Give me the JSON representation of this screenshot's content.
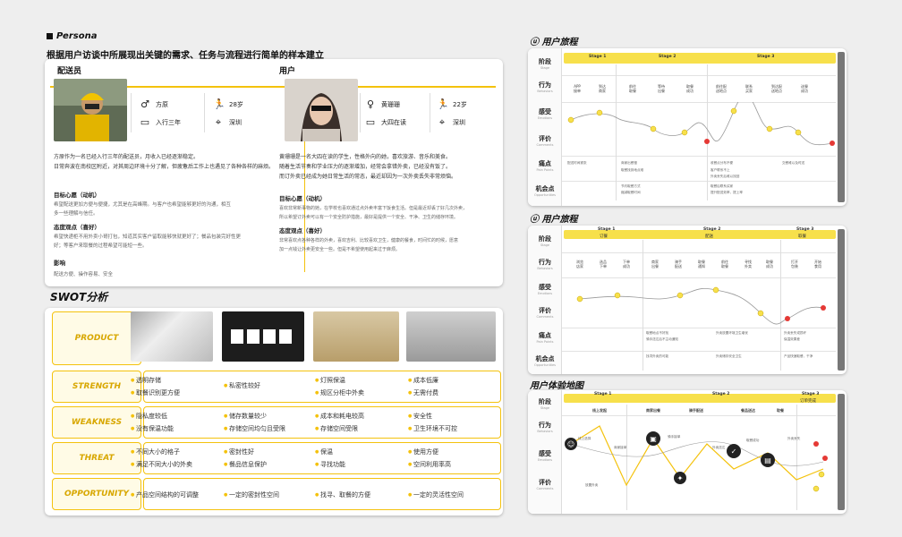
{
  "persona_header": {
    "title": "Persona",
    "subtitle": "根据用户访谈中所展现出关键的需求、任务与流程进行简单的样本建立"
  },
  "courier": {
    "title": "配送员",
    "name": "方原",
    "age": "28岁",
    "job": "入行三年",
    "city": "深圳",
    "bio": [
      "方原作为一名已经入行三年的配送员，月收入已经逐渐稳定。",
      "日常奔波在南校区附近，对其周边环境十分了解，但疲惫后工作上也遇见了各种各样的麻烦。"
    ],
    "goal_title": "目标心愿（动机）",
    "goal": [
      "希望配送更加方便与便捷，尤其是在高峰期。与客户也希望能够更好的沟通，相互",
      "多一些理解与信任。"
    ],
    "attitude_title": "态度观点（喜好）",
    "attitude": [
      "希望快递柜不用外卖小哥打包，知道其实客户留取能够快就更好了；餐品包装完好性更",
      "好；等客户来取餐的过程希望可能短一些。"
    ],
    "influence_title": "影响",
    "influence": "配送方便、操作容易、安全"
  },
  "user": {
    "title": "用户",
    "name": "黄珊珊",
    "age": "22岁",
    "job": "大四在读",
    "city": "深圳",
    "bio": [
      "黄珊珊是一名大四在读的学生，性格外向的她，喜欢旅游、音乐和美食。",
      "随着生活节奏和学业压力的逐渐增加，经常会拿错外卖，已经没有饭了。",
      "而订外卖已经成为她日常生活的常态，最近却因为一次外卖丢失非常烦恼。"
    ],
    "goal_title": "目标心愿（动机）",
    "goal": [
      "喜欢非常新事物的她，在学校也喜欢通过点外卖丰富下饭食生活。但是最近却丢了好几次外卖，",
      "所以希望订外卖可以有一个安全防护措施，最好是提供一个安全、干净、卫生的储存环境。"
    ],
    "attitude_title": "态度观点（喜好）",
    "attitude": [
      "非常喜欢点各种各样的外卖，喜欢吉利、比较喜欢卫生，健康的餐食，时间忙的时候，愿意",
      "加一点钱让外卖更安全一些。但是不希望使用起来过于麻烦。"
    ]
  },
  "swot": {
    "title": "SWOT分析",
    "rows": [
      {
        "label": "PRODUCT",
        "items": []
      },
      {
        "label": "STRENGTH",
        "items": [
          "透明存储",
          "私密性较好",
          "灯照保温",
          "成本低廉",
          "取餐识别更方便",
          "",
          "规区分柜中外卖",
          "无需付费"
        ]
      },
      {
        "label": "WEAKNESS",
        "items": [
          "隐私度较低",
          "储存数量较少",
          "成本和耗电较高",
          "安全性",
          "没有保温功能",
          "存储空间均匀且受限",
          "存储空间受限",
          "卫生环境不可控"
        ]
      },
      {
        "label": "THREAT",
        "items": [
          "不同大小的格子",
          "密封性好",
          "保温",
          "使用方便",
          "满足不同大小的外卖",
          "餐品信息保护",
          "寻找功能",
          "空间利用率高"
        ]
      },
      {
        "label": "OPPORTUNITY",
        "items": [
          "产品空间结构的可调整",
          "一定的密封性空间",
          "找寻、取餐的方便",
          "一定的灵活性空间"
        ]
      }
    ]
  },
  "journey1": {
    "title": "用户旅程",
    "rows": [
      {
        "m": "阶段",
        "s": "Stage"
      },
      {
        "m": "行为",
        "s": "Behaviors"
      },
      {
        "m": "感受",
        "s": "Emotions"
      },
      {
        "m": "评价",
        "s": "Comments"
      },
      {
        "m": "痛点",
        "s": "Pain Points"
      },
      {
        "m": "机会点",
        "s": "Opportunities"
      }
    ],
    "stages": [
      "Stage 1",
      "Stage 2",
      "Stage 3"
    ],
    "behaviors": [
      "APP\n接单",
      "到达\n商家",
      "前往\n取餐",
      "等待\n出餐",
      "取餐\n成功",
      "前往配\n送地点",
      "联系\n买家",
      "到达配\n送地点",
      "送餐\n成功"
    ],
    "pains": [
      "配送时间紧张",
      "商家出餐慢",
      "取餐找到地点难",
      "收餐点分布不便",
      "交餐难以及时送",
      "客户联系不上",
      "外卖丢失后难以找回"
    ],
    "opps": [
      "节约取餐方式",
      "缩减取餐时间",
      "取餐后联系买家",
      "提升配送效率，提上率"
    ]
  },
  "journey2": {
    "title": "用户旅程",
    "rows": [
      {
        "m": "阶段",
        "s": "Stage"
      },
      {
        "m": "行为",
        "s": "Behaviors"
      },
      {
        "m": "感受",
        "s": "Emotions"
      },
      {
        "m": "评价",
        "s": "Comments"
      },
      {
        "m": "痛点",
        "s": "Pain Points"
      },
      {
        "m": "机会点",
        "s": "Opportunities"
      }
    ],
    "stages": [
      "Stage 1",
      "Stage 2",
      "Stage 3"
    ],
    "phases": [
      "订餐",
      "配送",
      "取餐"
    ],
    "behaviors": [
      "浏览\n店家",
      "选品\n下单",
      "下单\n成功",
      "商家\n出餐",
      "骑手\n配送",
      "取餐\n通知",
      "前往\n取餐",
      "寻找\n外卖",
      "取餐\n成功",
      "打开\n包装",
      "开始\n食用"
    ],
    "pains": [
      "取餐地点不好找",
      "骑手送达后不主动通知",
      "外卖放置环境卫生堪忧",
      "外卖丢失或损坏",
      "保温效果差"
    ],
    "opps": [
      "找寻外卖的可能",
      "外卖储存安全卫生",
      "产品快速取餐，干净"
    ]
  },
  "journey3": {
    "title": "用户体验地图",
    "rows": [
      {
        "m": "阶段",
        "s": "Stage"
      },
      {
        "m": "行为",
        "s": "Behaviors"
      },
      {
        "m": "感受",
        "s": "Emotions"
      },
      {
        "m": "评价",
        "s": "Comments"
      }
    ],
    "stages": [
      "Stage 1",
      "Stage 2",
      "Stage 3"
    ],
    "phase3": "订单完成",
    "behaviors": [
      "线上发起",
      "商家出餐",
      "骑手配送",
      "餐品送达",
      "取餐"
    ],
    "notes": [
      "线上选择",
      "商家接单",
      "骑手接单",
      "外卖送达",
      "取餐成功",
      "外卖丢失",
      "放置外卖"
    ]
  }
}
